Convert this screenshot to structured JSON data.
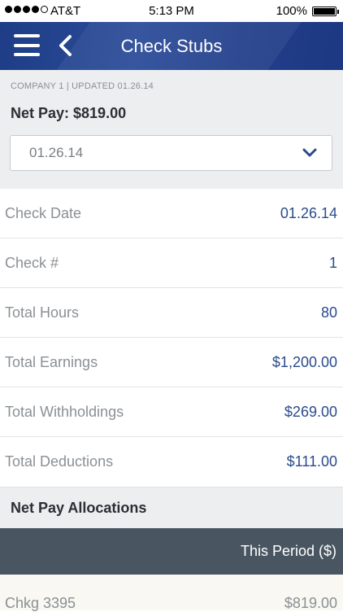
{
  "status_bar": {
    "carrier": "AT&T",
    "time": "5:13 PM",
    "battery": "100%"
  },
  "header": {
    "title": "Check Stubs",
    "menu_icon": "hamburger-menu-icon",
    "back_icon": "chevron-left-icon"
  },
  "summary": {
    "company_line": "COMPANY 1 | UPDATED 01.26.14",
    "net_pay": "Net Pay: $819.00",
    "selected_date": "01.26.14",
    "dropdown_icon": "chevron-down-icon"
  },
  "details": [
    {
      "label": "Check Date",
      "value": "01.26.14"
    },
    {
      "label": "Check #",
      "value": "1"
    },
    {
      "label": "Total Hours",
      "value": "80"
    },
    {
      "label": "Total Earnings",
      "value": "$1,200.00"
    },
    {
      "label": "Total Withholdings",
      "value": "$269.00"
    },
    {
      "label": "Total Deductions",
      "value": "$111.00"
    }
  ],
  "allocations": {
    "title": "Net Pay Allocations",
    "column_header": "This Period ($)",
    "rows": [
      {
        "account": "Chkg 3395",
        "amount": "$819.00"
      }
    ]
  },
  "colors": {
    "header_blue": "#233f8b",
    "value_blue": "#2a4b8c",
    "table_header": "#495661"
  }
}
